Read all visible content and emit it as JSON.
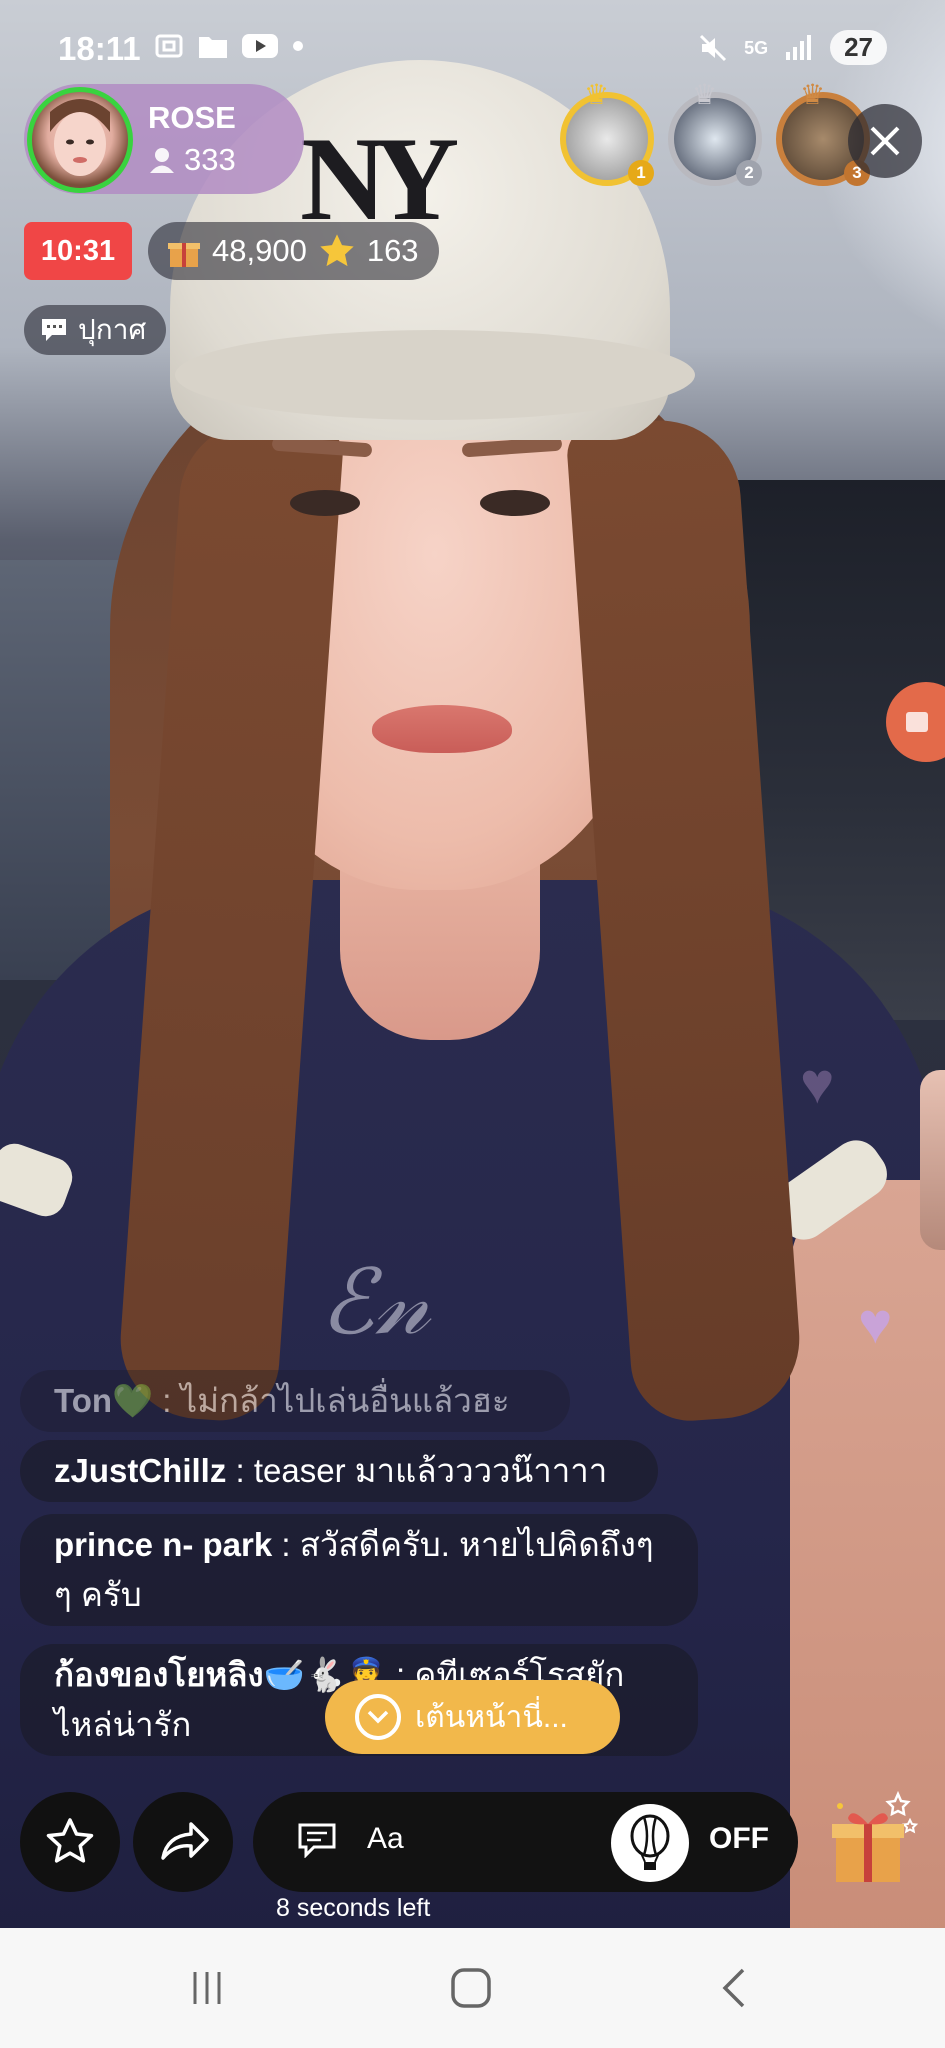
{
  "status_bar": {
    "time": "18:11",
    "network": "5G",
    "battery": "27",
    "icons_left": [
      "screenshot-icon",
      "folder-icon",
      "youtube-icon",
      "notification-dot-icon"
    ],
    "icons_right": [
      "mute-icon",
      "network-arrows-icon",
      "signal-icon",
      "battery-icon"
    ]
  },
  "streamer": {
    "name": "ROSE",
    "viewers": "333",
    "online_ring_color": "#39d33f"
  },
  "top_fans": [
    {
      "rank": "1",
      "tier": "gold"
    },
    {
      "rank": "2",
      "tier": "silver"
    },
    {
      "rank": "3",
      "tier": "bronze"
    }
  ],
  "live": {
    "timer": "10:31",
    "gifts": "48,900",
    "stars": "163",
    "announcement_label": "ปุกาศ"
  },
  "chat": [
    {
      "user": "Ton💚",
      "separator": " : ",
      "text": "ไม่กล้าไปเล่นอื่นแล้วฮะ"
    },
    {
      "user": "zJustChillz",
      "separator": " : ",
      "text": "teaser มาแล้ววววน๊าาาา"
    },
    {
      "user": "prince n- park",
      "separator": " : ",
      "text": "สวัสดีครับ.  หายไปคิดถึงๆๆ ครับ"
    },
    {
      "user": "ก้องของโยหลิง🥣🐇👮",
      "separator": " : ",
      "text": "คุทีเซอร์โรสยักไหล่น่ารัก"
    }
  ],
  "dance_prompt": "เต้นหน้านี่...",
  "composer": {
    "placeholder": "Aa",
    "balloon_state": "OFF",
    "countdown": "8 seconds left"
  },
  "colors": {
    "timer_bg": "#f04646",
    "dance_pill_bg": "#f2b84b",
    "streamer_card_bg": "#b18cc3"
  }
}
